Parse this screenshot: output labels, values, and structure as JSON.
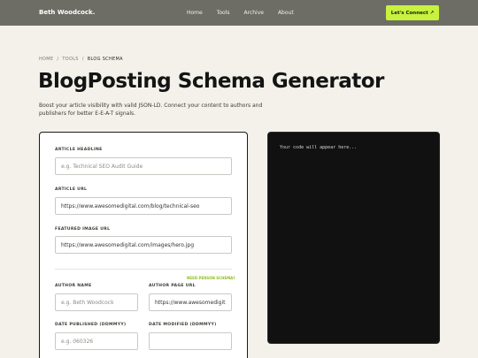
{
  "nav": {
    "brand": "Beth Woodcock.",
    "links": [
      "Home",
      "Tools",
      "Archive",
      "About"
    ],
    "cta": "Let's Connect ↗"
  },
  "breadcrumb": {
    "items": [
      "HOME",
      "TOOLS",
      "BLOG SCHEMA"
    ],
    "separator": "/"
  },
  "page": {
    "title": "BlogPosting Schema Generator",
    "subtitle": "Boost your article visibility with valid JSON-LD. Connect your content to authors and publishers for better E-E-A-T signals."
  },
  "form": {
    "headline": {
      "label": "ARTICLE HEADLINE",
      "placeholder": "e.g. Technical SEO Audit Guide"
    },
    "url": {
      "label": "ARTICLE URL",
      "value": "https://www.awesomedigital.com/blog/technical-seo"
    },
    "image": {
      "label": "FEATURED IMAGE URL",
      "value": "https://www.awesomedigital.com/images/hero.jpg"
    },
    "person_hint": "NEED PERSON SCHEMA?",
    "author_name": {
      "label": "AUTHOR NAME",
      "placeholder": "e.g. Beth Woodcock"
    },
    "author_url": {
      "label": "AUTHOR PAGE URL",
      "value": "https://www.awesomedigit"
    },
    "date_published": {
      "label": "DATE PUBLISHED (DDMMYY)",
      "placeholder": "e.g. 060326"
    },
    "date_modified": {
      "label": "DATE MODIFIED (DDMMYY)",
      "value": ""
    }
  },
  "code": {
    "placeholder": "Your code will appear here..."
  },
  "colors": {
    "nav_bg": "#6d6d66",
    "accent": "#c7f23e",
    "page_bg": "#f3f1ea",
    "code_bg": "#111111"
  }
}
